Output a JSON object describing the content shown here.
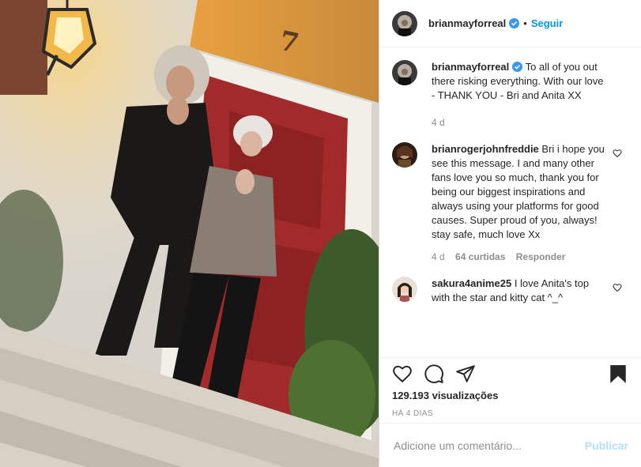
{
  "header": {
    "username": "brianmayforreal",
    "dot": "•",
    "follow_label": "Seguir"
  },
  "caption": {
    "username": "brianmayforreal",
    "text": "To all of you out there risking everything. With our love - THANK YOU - Bri and Anita XX",
    "time": "4 d"
  },
  "comments": [
    {
      "username": "brianrogerjohnfreddie",
      "text": "Bri i hope you see this message. I and many other fans love you so much, thank you for being our biggest inspirations and always using your platforms for good causes. Super proud of you, always! stay safe, much love Xx",
      "time": "4 d",
      "likes": "64 curtidas",
      "reply_label": "Responder"
    },
    {
      "username": "sakura4anime25",
      "text": "I love Anita's top with the star and kitty cat ^_^"
    }
  ],
  "media": {
    "door_number": "7"
  },
  "actions": {
    "icons": [
      "heart-icon",
      "comment-icon",
      "share-icon",
      "bookmark-icon"
    ],
    "views": "129.193 visualizações",
    "date": "HÁ 4 DIAS"
  },
  "add_comment": {
    "placeholder": "Adicione um comentário...",
    "publish_label": "Publicar"
  },
  "colors": {
    "accent": "#0095f6",
    "publish_disabled": "#b2dffc",
    "door": "#a32a2b"
  }
}
